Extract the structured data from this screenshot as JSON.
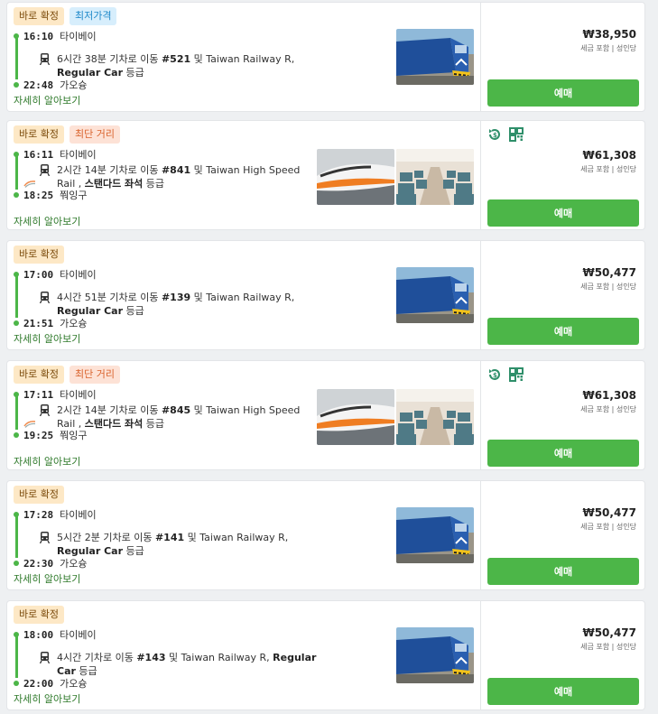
{
  "common": {
    "instant_badge": "바로 확정",
    "more_link": "자세히 알아보기",
    "price_note": "세금 포함 | 성인당",
    "book_label": "예매"
  },
  "colors": {
    "accent_green": "#4cb648",
    "cheapest_badge_bg": "#d7eefc",
    "shortest_badge_bg": "#fde2d6",
    "instant_badge_bg": "#fde8c6"
  },
  "results": [
    {
      "badge2": "최저가격",
      "dep_time": "16:10",
      "dep_station": "타이베이",
      "arr_time": "22:48",
      "arr_station": "가오슝",
      "ride_pre": "6시간 38분 기차로 이동 ",
      "train_no": "#521",
      "ride_mid": " 및 Taiwan Railway R, ",
      "class": "Regular Car",
      "ride_post": " 등급",
      "price": "₩38,950",
      "icon": "train-icon"
    },
    {
      "badge2": "최단 거리",
      "dep_time": "16:11",
      "dep_station": "타이베이",
      "arr_time": "18:25",
      "arr_station": "쭤잉구",
      "ride_pre": "2시간 14분 기차로 이동 ",
      "train_no": "#841",
      "ride_mid": " 및 Taiwan High Speed Rail , ",
      "class": "스탠다드 좌석",
      "ride_post": " 등급",
      "price": "₩61,308",
      "icon": "hsr-train-icon",
      "extra_icons": [
        "refund-icon",
        "qr-ticket-icon"
      ]
    },
    {
      "dep_time": "17:00",
      "dep_station": "타이베이",
      "arr_time": "21:51",
      "arr_station": "가오슝",
      "ride_pre": "4시간 51분 기차로 이동 ",
      "train_no": "#139",
      "ride_mid": " 및 Taiwan Railway R, ",
      "class": "Regular Car",
      "ride_post": " 등급",
      "price": "₩50,477",
      "icon": "train-icon"
    },
    {
      "badge2": "최단 거리",
      "dep_time": "17:11",
      "dep_station": "타이베이",
      "arr_time": "19:25",
      "arr_station": "쭤잉구",
      "ride_pre": "2시간 14분 기차로 이동 ",
      "train_no": "#845",
      "ride_mid": " 및 Taiwan High Speed Rail , ",
      "class": "스탠다드 좌석",
      "ride_post": " 등급",
      "price": "₩61,308",
      "icon": "hsr-train-icon",
      "extra_icons": [
        "refund-icon",
        "qr-ticket-icon"
      ]
    },
    {
      "dep_time": "17:28",
      "dep_station": "타이베이",
      "arr_time": "22:30",
      "arr_station": "가오슝",
      "ride_pre": "5시간 2분 기차로 이동 ",
      "train_no": "#141",
      "ride_mid": " 및 Taiwan Railway R, ",
      "class": "Regular Car",
      "ride_post": " 등급",
      "price": "₩50,477",
      "icon": "train-icon"
    },
    {
      "dep_time": "18:00",
      "dep_station": "타이베이",
      "arr_time": "22:00",
      "arr_station": "가오슝",
      "ride_pre": "4시간 기차로 이동 ",
      "train_no": "#143",
      "ride_mid": " 및 Taiwan Railway R, ",
      "class": "Regular Car",
      "ride_post": " 등급",
      "price": "₩50,477",
      "icon": "train-icon"
    }
  ]
}
